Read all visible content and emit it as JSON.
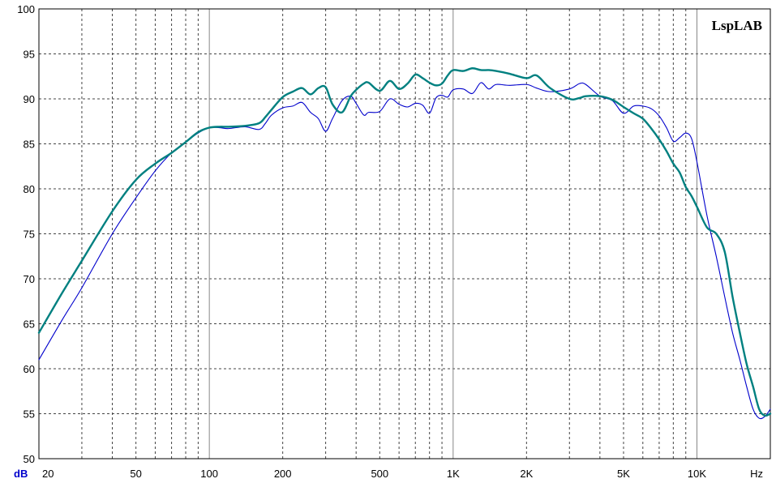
{
  "chart_data": {
    "type": "line",
    "title": "",
    "watermark": "LspLAB",
    "xlabel": "Hz",
    "ylabel": "dB",
    "x_scale": "log",
    "xlim": [
      20,
      20000
    ],
    "ylim": [
      50,
      100
    ],
    "grid": true,
    "yticks": [
      50,
      55,
      60,
      65,
      70,
      75,
      80,
      85,
      90,
      95,
      100
    ],
    "ytick_labels": [
      "50",
      "55",
      "60",
      "65",
      "70",
      "75",
      "80",
      "85",
      "90",
      "95",
      "100"
    ],
    "xticks": [
      20,
      50,
      100,
      200,
      500,
      1000,
      2000,
      5000,
      10000
    ],
    "xtick_labels": [
      "20",
      "50",
      "100",
      "200",
      "500",
      "1K",
      "2K",
      "5K",
      "10K"
    ],
    "series": [
      {
        "color": "#0000cc",
        "x": [
          20,
          25,
          30,
          40,
          50,
          60,
          70,
          80,
          90,
          100,
          110,
          120,
          140,
          160,
          170,
          180,
          200,
          220,
          240,
          260,
          280,
          300,
          320,
          350,
          380,
          400,
          430,
          450,
          500,
          550,
          600,
          650,
          700,
          750,
          800,
          850,
          900,
          950,
          1000,
          1100,
          1200,
          1300,
          1400,
          1500,
          1700,
          2000,
          2200,
          2500,
          3000,
          3300,
          3500,
          4000,
          4500,
          5000,
          5500,
          6000,
          6500,
          7000,
          7500,
          8000,
          8500,
          9000,
          9500,
          10000,
          11000,
          12000,
          13000,
          14000,
          15000,
          16000,
          17000,
          18000,
          19000,
          20000
        ],
        "values": [
          61,
          65.5,
          69,
          75,
          79,
          82,
          84,
          85.2,
          86.2,
          86.8,
          86.8,
          86.7,
          86.9,
          86.6,
          87.3,
          88.2,
          89,
          89.2,
          89.6,
          88.5,
          87.8,
          86.4,
          87.8,
          89.8,
          90.3,
          89.5,
          88.2,
          88.5,
          88.6,
          90,
          89.4,
          89.1,
          89.5,
          89.3,
          88.4,
          90.1,
          90.4,
          90.2,
          91,
          91.1,
          90.6,
          91.8,
          91.1,
          91.6,
          91.5,
          91.6,
          91.2,
          90.8,
          91.1,
          91.7,
          91.6,
          90.3,
          89.8,
          88.4,
          89.2,
          89.2,
          88.9,
          88.1,
          86.8,
          85.3,
          85.7,
          86.2,
          85.6,
          83,
          77,
          72.5,
          68,
          64,
          61,
          58,
          55.5,
          54.5,
          54.7,
          55.5
        ]
      },
      {
        "color": "#008080",
        "x": [
          20,
          25,
          30,
          40,
          50,
          60,
          70,
          80,
          90,
          100,
          110,
          120,
          140,
          160,
          170,
          180,
          200,
          220,
          240,
          260,
          280,
          300,
          320,
          350,
          380,
          400,
          430,
          450,
          500,
          550,
          600,
          650,
          700,
          750,
          800,
          850,
          900,
          950,
          1000,
          1100,
          1200,
          1300,
          1400,
          1500,
          1700,
          2000,
          2200,
          2500,
          3000,
          3300,
          3500,
          4000,
          4500,
          5000,
          5500,
          6000,
          6500,
          7000,
          7500,
          8000,
          8500,
          9000,
          9500,
          10000,
          11000,
          12000,
          13000,
          14000,
          15000,
          16000,
          17000,
          18000,
          19000,
          20000
        ],
        "values": [
          64,
          68.5,
          72,
          77.5,
          81,
          82.8,
          84,
          85.2,
          86.3,
          86.8,
          86.9,
          86.9,
          87,
          87.3,
          88,
          88.8,
          90.2,
          90.8,
          91.2,
          90.5,
          91.2,
          91.3,
          89.4,
          88.5,
          90.3,
          91,
          91.7,
          91.8,
          90.9,
          92,
          91.1,
          91.7,
          92.7,
          92.3,
          91.8,
          91.5,
          91.7,
          92.6,
          93.2,
          93.1,
          93.4,
          93.2,
          93.2,
          93.1,
          92.8,
          92.3,
          92.6,
          91.2,
          90,
          90.1,
          90.3,
          90.3,
          89.9,
          89.1,
          88.4,
          87.8,
          86.7,
          85.5,
          84.2,
          82.8,
          81.8,
          80.2,
          79.2,
          78,
          75.7,
          75,
          73,
          68,
          64,
          60.5,
          58,
          55.5,
          54.8,
          55
        ]
      }
    ]
  }
}
